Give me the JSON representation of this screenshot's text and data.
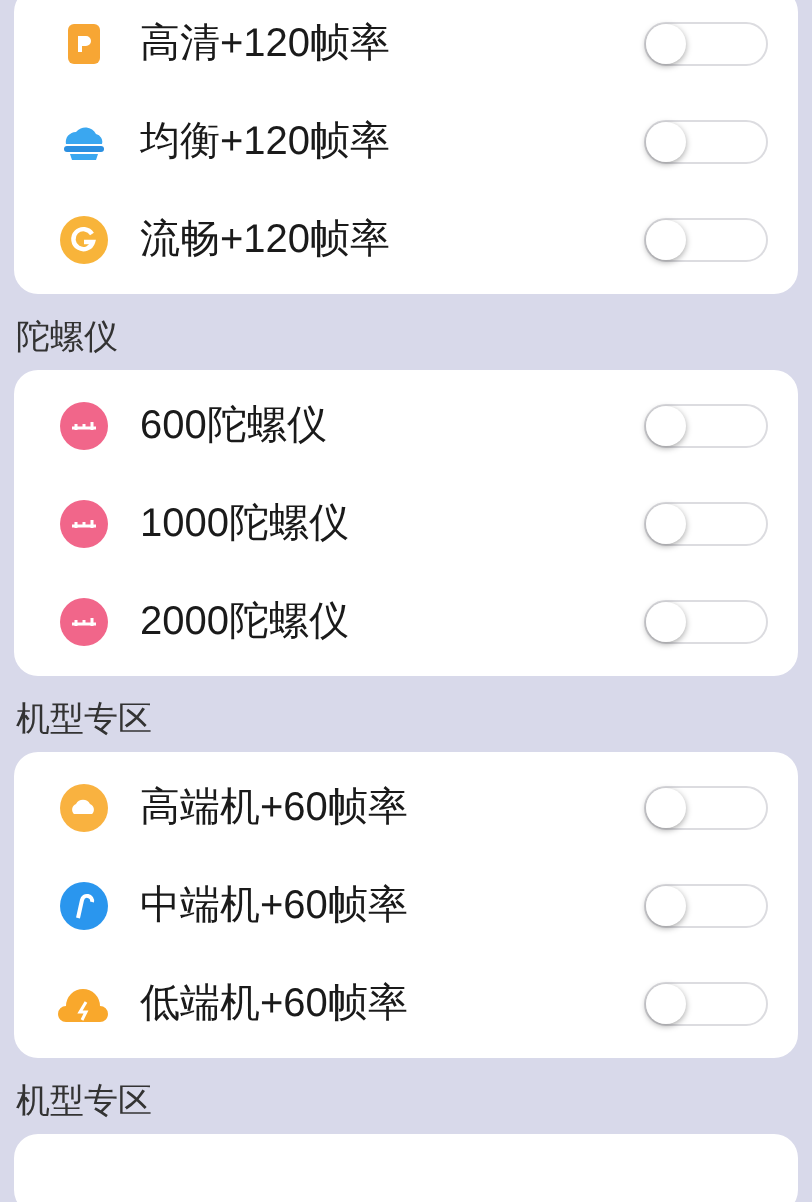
{
  "sections": [
    {
      "items": [
        {
          "label": "高清+120帧率",
          "on": false
        },
        {
          "label": "均衡+120帧率",
          "on": false
        },
        {
          "label": "流畅+120帧率",
          "on": false
        }
      ]
    },
    {
      "title": "陀螺仪",
      "items": [
        {
          "label": "600陀螺仪",
          "on": false
        },
        {
          "label": "1000陀螺仪",
          "on": false
        },
        {
          "label": "2000陀螺仪",
          "on": false
        }
      ]
    },
    {
      "title": "机型专区",
      "items": [
        {
          "label": "高端机+60帧率",
          "on": false
        },
        {
          "label": "中端机+60帧率",
          "on": false
        },
        {
          "label": "低端机+60帧率",
          "on": false
        }
      ]
    },
    {
      "title": "机型专区"
    }
  ]
}
